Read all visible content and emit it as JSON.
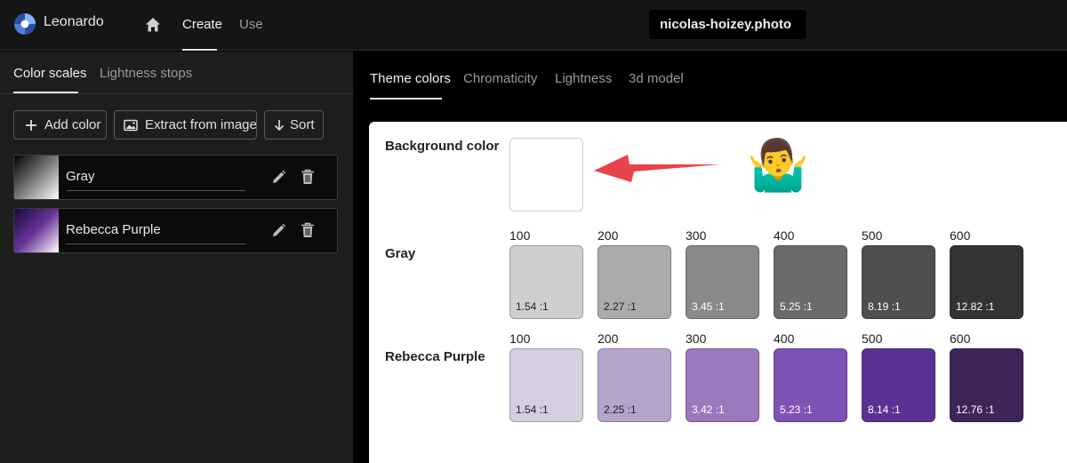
{
  "app": {
    "title": "Leonardo"
  },
  "nav": {
    "create": "Create",
    "use": "Use"
  },
  "credit": "nicolas-hoizey.photo",
  "left": {
    "tabs": [
      "Color scales",
      "Lightness stops"
    ],
    "buttons": {
      "add": "Add color",
      "extract": "Extract from image",
      "sort": "Sort"
    },
    "scales": [
      "Gray",
      "Rebecca Purple"
    ]
  },
  "right": {
    "tabs": [
      "Theme colors",
      "Chromaticity",
      "Lightness",
      "3d model"
    ]
  },
  "theme": {
    "background_label": "Background color",
    "background_color": "#ffffff",
    "emoji": "🤷‍♂️",
    "rows": [
      {
        "name": "Gray",
        "swatches": [
          {
            "step": "100",
            "ratio": "1.54 :1",
            "color": "#cfcfcf",
            "text": "#222222"
          },
          {
            "step": "200",
            "ratio": "2.27 :1",
            "color": "#ababab",
            "text": "#222222"
          },
          {
            "step": "300",
            "ratio": "3.45 :1",
            "color": "#898989",
            "text": "#ffffff"
          },
          {
            "step": "400",
            "ratio": "5.25 :1",
            "color": "#6b6b6b",
            "text": "#ffffff"
          },
          {
            "step": "500",
            "ratio": "8.19 :1",
            "color": "#4e4e4e",
            "text": "#ffffff"
          },
          {
            "step": "600",
            "ratio": "12.82 :1",
            "color": "#333333",
            "text": "#ffffff"
          }
        ]
      },
      {
        "name": "Rebecca Purple",
        "swatches": [
          {
            "step": "100",
            "ratio": "1.54 :1",
            "color": "#d5cde0",
            "text": "#222222"
          },
          {
            "step": "200",
            "ratio": "2.25 :1",
            "color": "#b7a4cb",
            "text": "#222222"
          },
          {
            "step": "300",
            "ratio": "3.42 :1",
            "color": "#9a79bc",
            "text": "#ffffff"
          },
          {
            "step": "400",
            "ratio": "5.23 :1",
            "color": "#7e52b7",
            "text": "#ffffff"
          },
          {
            "step": "500",
            "ratio": "8.14 :1",
            "color": "#5c3194",
            "text": "#ffffff"
          },
          {
            "step": "600",
            "ratio": "12.76 :1",
            "color": "#3d2559",
            "text": "#ffffff"
          }
        ]
      }
    ]
  },
  "colors": {
    "arrow": "#e8424a",
    "accent": "#5b8def"
  }
}
